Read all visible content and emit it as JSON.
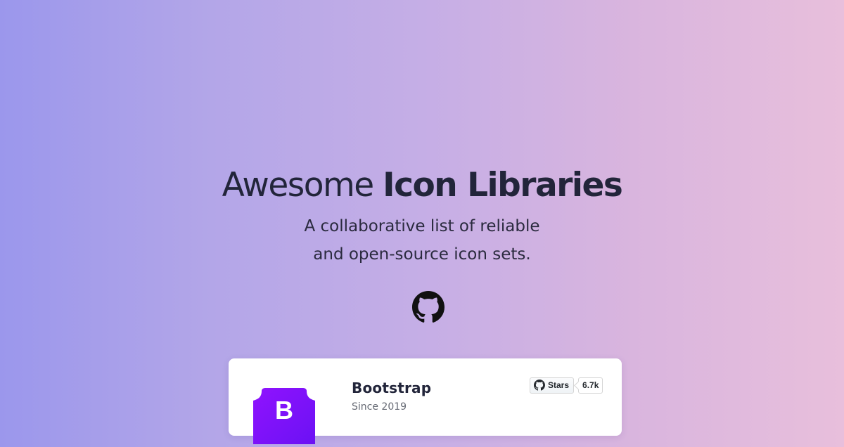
{
  "hero": {
    "title_light": "Awesome ",
    "title_bold": "Icon Libraries",
    "subtitle_line1": "A collaborative list of reliable",
    "subtitle_line2": "and open-source icon sets."
  },
  "icons": {
    "repo_link": "github-icon",
    "star_button": "github-icon",
    "library_logo": "bootstrap-logo-icon"
  },
  "colors": {
    "gradient_start": "#9b97ec",
    "gradient_end": "#e8bfdc",
    "bootstrap_purple": "#7952b3"
  },
  "libraries": [
    {
      "name": "Bootstrap",
      "since": "Since 2019",
      "logo_letter": "B",
      "stars_label": "Stars",
      "stars_count": "6.7k"
    }
  ]
}
